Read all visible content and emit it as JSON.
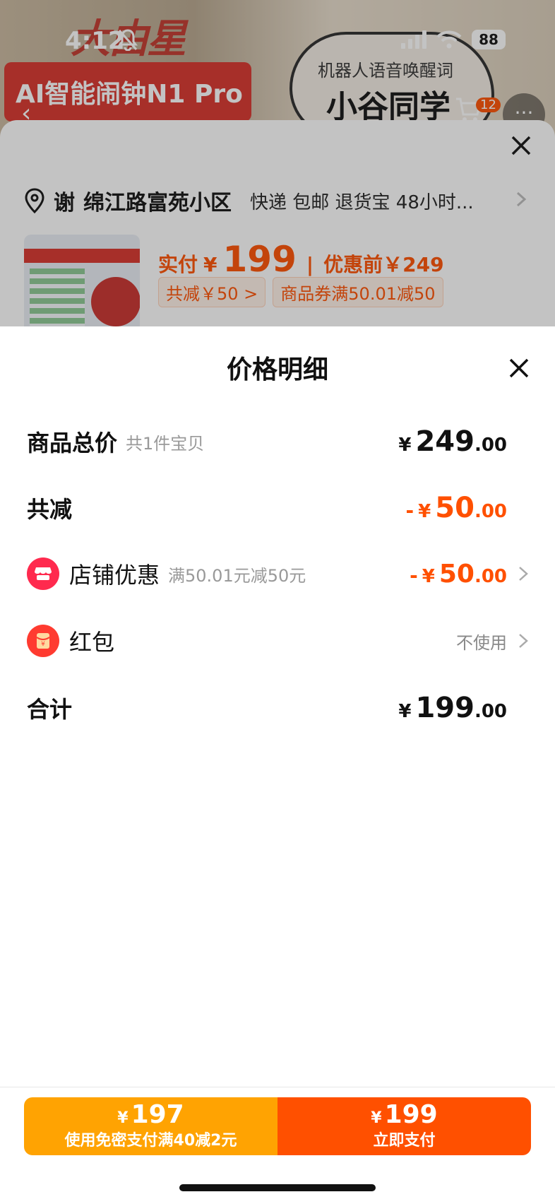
{
  "status_bar": {
    "time": "4:12",
    "battery": "88"
  },
  "hero": {
    "brand": "大由星",
    "banner": "AI智能闹钟N1 Pro",
    "bubble_sub": "机器人语音唤醒词",
    "bubble_title": "小谷同学",
    "cart_count": "12"
  },
  "order": {
    "address_name": "谢",
    "address": "绵江路富苑小区",
    "shipping": "快递 包邮 退货宝 48小时...",
    "price_label": "实付",
    "price_yen": "¥",
    "price": "199",
    "orig_price": "优惠前￥249",
    "tags": [
      "共减￥50 >",
      "商品券满50.01减50"
    ]
  },
  "sheet": {
    "title": "价格明细",
    "total": {
      "label": "商品总价",
      "sub": "共1件宝贝",
      "yen": "¥",
      "int": "249",
      "dec": ".00"
    },
    "discount": {
      "label": "共减",
      "minus": "-",
      "yen": "¥",
      "int": "50",
      "dec": ".00"
    },
    "store": {
      "label": "店铺优惠",
      "sub": "满50.01元减50元",
      "minus": "-",
      "yen": "¥",
      "int": "50",
      "dec": ".00"
    },
    "hongbao": {
      "label": "红包",
      "value": "不使用"
    },
    "sum": {
      "label": "合计",
      "yen": "¥",
      "int": "199",
      "dec": ".00"
    }
  },
  "pay": {
    "left": {
      "yen": "¥",
      "amount": "197",
      "desc": "使用免密支付满40减2元"
    },
    "right": {
      "yen": "¥",
      "amount": "199",
      "desc": "立即支付"
    }
  },
  "colors": {
    "accent": "#ff5000",
    "pay_left": "#ffa302",
    "store_icon": "#ff2a4e"
  },
  "icons": [
    "bell-slash-icon",
    "signal-icon",
    "wifi-icon",
    "battery-icon",
    "close-icon",
    "location-pin-icon",
    "chevron-right-icon",
    "store-icon",
    "red-packet-icon"
  ]
}
